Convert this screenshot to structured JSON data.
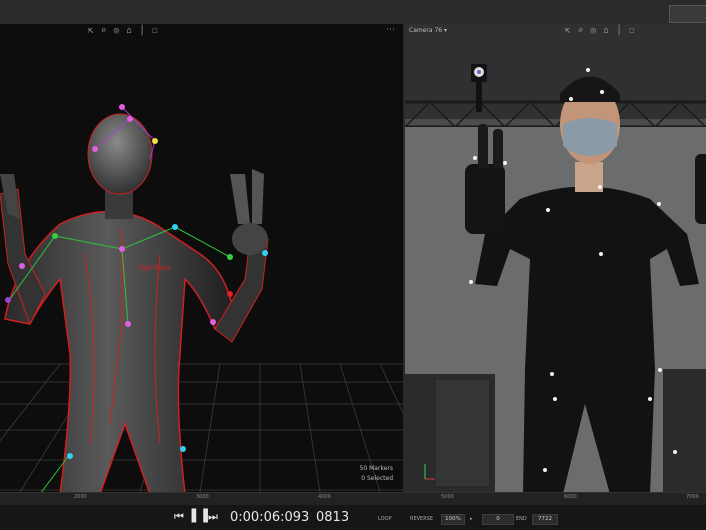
{
  "left_viewport": {
    "markers_count": "50 Markers",
    "selected_count": "0 Selected"
  },
  "right_viewport": {
    "camera_label": "Camera 76"
  },
  "timeline": {
    "ticks": [
      "2000",
      "3000",
      "4000",
      "5000",
      "6000",
      "7000"
    ]
  },
  "transport": {
    "timecode": "0:00:06:093",
    "frame": "0813",
    "loop_label": "LOOP",
    "reverse_label": "REVERSE",
    "speed_value": "100%",
    "start_value": "0",
    "end_label": "END",
    "end_value": "7722"
  }
}
